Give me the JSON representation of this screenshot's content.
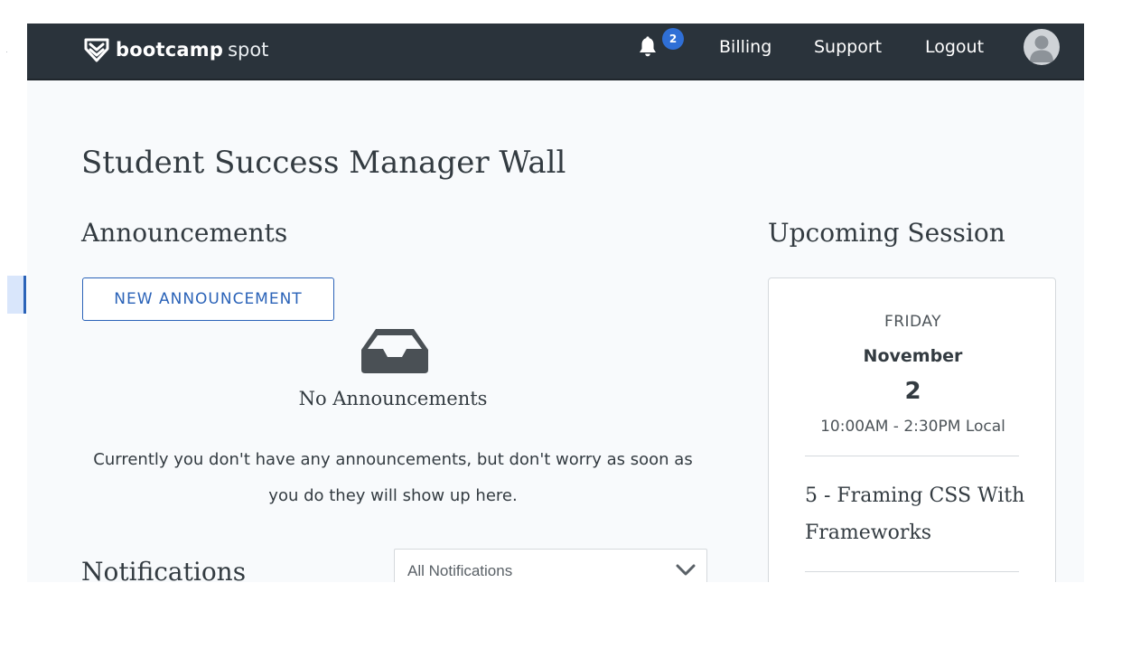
{
  "header": {
    "brand_bold": "bootcamp",
    "brand_light": "spot",
    "brand_icon": "bootcampspot-chevron-shield-icon",
    "notifications_icon": "bell-icon",
    "notification_count": "2",
    "nav": {
      "billing": "Billing",
      "support": "Support",
      "logout": "Logout"
    },
    "avatar_icon": "user-avatar-icon"
  },
  "page": {
    "title": "Student Success Manager Wall"
  },
  "announcements": {
    "title": "Announcements",
    "new_button": "NEW ANNOUNCEMENT",
    "empty_icon": "inbox-tray-icon",
    "empty_title": "No Announcements",
    "empty_text": "Currently you don't have any announcements, but don't worry as soon as you do they will show up here."
  },
  "notifications": {
    "title": "Notifications",
    "filter_selected": "All Notifications",
    "filter_icon": "chevron-down-icon"
  },
  "upcoming_session": {
    "title": "Upcoming Session",
    "day": "FRIDAY",
    "month": "November",
    "date": "2",
    "time": "10:00AM - 2:30PM Local",
    "topic": "5 - Framing CSS With Frameworks"
  },
  "colors": {
    "header_bg": "#2a333b",
    "accent": "#2b63b8",
    "badge": "#2f6fd6",
    "page_bg": "#f8fafc",
    "text": "#333b41"
  }
}
